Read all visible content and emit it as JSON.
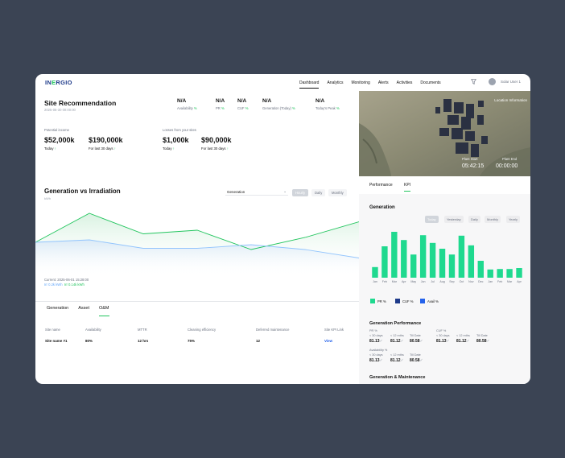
{
  "brand": {
    "pre": "IN",
    "accent": "E",
    "post": "RGIO"
  },
  "nav": [
    "Dashboard",
    "Analytics",
    "Monitoring",
    "Alerts",
    "Activities",
    "Documents"
  ],
  "user": "Solar User 1",
  "site": {
    "title": "Site Recommendation",
    "date": "2025-06-30 00:00:00"
  },
  "kpis": [
    {
      "value": "N/A",
      "label": "Availability",
      "unit": "%"
    },
    {
      "value": "N/A",
      "label": "PR",
      "unit": "%"
    },
    {
      "value": "N/A",
      "label": "CUF",
      "unit": "%"
    },
    {
      "value": "N/A",
      "label": "Generation (Today)",
      "unit": "%"
    },
    {
      "value": "N/A",
      "label": "Today's Peak",
      "unit": "%"
    }
  ],
  "income": {
    "label": "Potential income",
    "today": {
      "value": "$52,000k",
      "label": "Today",
      "unit": "↑"
    },
    "month": {
      "value": "$190,000k",
      "label": "For last 30 days",
      "unit": "↑"
    }
  },
  "losses": {
    "label": "Losses from your sites",
    "today": {
      "value": "$1,000k",
      "label": "Today",
      "unit": "↑"
    },
    "month": {
      "value": "$90,000k",
      "label": "For last 30 days",
      "unit": "↑"
    }
  },
  "gen_chart": {
    "title": "Generation vs Irradiation",
    "unit": "kWh",
    "select": "Generation",
    "periods": [
      "Hourly",
      "Daily",
      "Monthly"
    ],
    "current": "Current: 2025-06-01 15:28:00",
    "irr_line": "Irr 0.2k kWh",
    "gen_line": "Irr 0.14k kWh"
  },
  "chart_data": {
    "type": "line",
    "x": [
      0,
      1,
      2,
      3,
      4,
      5,
      6
    ],
    "series": [
      {
        "values": [
          140,
          260,
          175,
          190,
          110,
          160,
          225
        ]
      },
      {
        "values": [
          140,
          150,
          115,
          115,
          130,
          110,
          75
        ]
      }
    ],
    "ylim": [
      0,
      300
    ]
  },
  "tabs": [
    "Generation",
    "Asset",
    "O&M"
  ],
  "table": {
    "headers": [
      "Site name",
      "Availability",
      "MTTR",
      "Cleaning efficiency",
      "Deferred maintenance",
      "Site KPI Link"
    ],
    "row": [
      "Site name #1",
      "80%",
      "12 hrs",
      "75%",
      "12",
      "View"
    ]
  },
  "map": {
    "location": "Location Information",
    "start_label": "Plant Start",
    "start": "05:42:15",
    "end_label": "Plant End",
    "end": "00:00:00"
  },
  "right_tabs": [
    "Performance",
    "KPI"
  ],
  "right_gen": {
    "title": "Generation",
    "periods": [
      "Today",
      "Yesterday",
      "Daily",
      "Monthly",
      "Yearly"
    ],
    "months": [
      "Jan",
      "Feb",
      "Mar",
      "Apr",
      "May",
      "Jun",
      "Jul",
      "Aug",
      "Sep",
      "Oct",
      "Nov",
      "Dec",
      "Jan",
      "Feb",
      "Mar",
      "Apr"
    ],
    "values": [
      22,
      65,
      95,
      78,
      48,
      88,
      72,
      60,
      48,
      87,
      67,
      35,
      17,
      18,
      18,
      20
    ],
    "legend": [
      "PR %",
      "CUF %",
      "Avail %"
    ]
  },
  "perf": {
    "title": "Generation Performance",
    "pr": {
      "label": "PR %",
      "cols": [
        {
          "l": "< 30 days",
          "v": "81.13"
        },
        {
          "l": "< 12 mths",
          "v": "81.12"
        },
        {
          "l": "Till Date",
          "v": "80.58"
        }
      ]
    },
    "cuf": {
      "label": "CUF %",
      "cols": [
        {
          "l": "< 30 days",
          "v": "81.13"
        },
        {
          "l": "< 12 mths",
          "v": "81.12"
        },
        {
          "l": "Till Date",
          "v": "80.58"
        }
      ]
    },
    "avail": {
      "label": "Availability %",
      "cols": [
        {
          "l": "< 30 days",
          "v": "81.13"
        },
        {
          "l": "< 12 mths",
          "v": "81.12"
        },
        {
          "l": "Till Date",
          "v": "80.58"
        }
      ]
    },
    "check": "✓"
  },
  "maint_title": "Generation & Maintenance",
  "colors": {
    "green": "#22c55e",
    "bar": "#1fd98f",
    "navy": "#1e3a8a",
    "blue": "#2563eb"
  }
}
